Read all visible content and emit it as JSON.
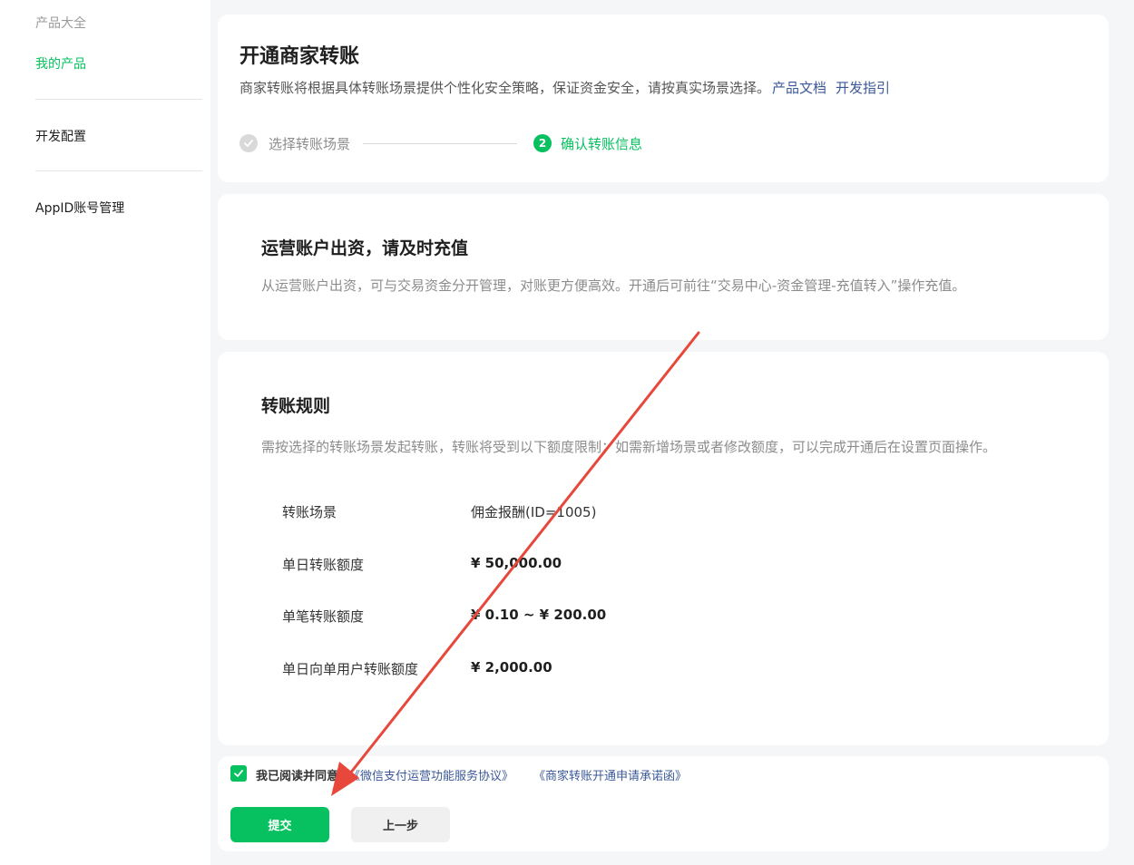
{
  "sidebar": {
    "group_title": "产品大全",
    "items": [
      {
        "label": "我的产品"
      },
      {
        "label": "开发配置"
      },
      {
        "label": "AppID账号管理"
      }
    ]
  },
  "header": {
    "title": "开通商家转账",
    "description": "商家转账将根据具体转账场景提供个性化安全策略，保证资金安全，请按真实场景选择。",
    "links": {
      "doc": "产品文档",
      "guide": "开发指引"
    }
  },
  "steps": [
    {
      "label": "选择转账场景",
      "status": "done"
    },
    {
      "number": "2",
      "label": "确认转账信息",
      "status": "active"
    }
  ],
  "operating_account": {
    "title": "运营账户出资，请及时充值",
    "description": "从运营账户出资，可与交易资金分开管理，对账更方便高效。开通后可前往“交易中心-资金管理-充值转入”操作充值。"
  },
  "rules": {
    "title": "转账规则",
    "description": "需按选择的转账场景发起转账，转账将受到以下额度限制；如需新增场景或者修改额度，可以完成开通后在设置页面操作。",
    "rows": [
      {
        "label": "转账场景",
        "value": "佣金报酬(ID=1005)"
      },
      {
        "label": "单日转账额度",
        "value": "¥ 50,000.00"
      },
      {
        "label": "单笔转账额度",
        "value": "¥ 0.10 ~ ¥ 200.00"
      },
      {
        "label": "单日向单用户转账额度",
        "value": "¥ 2,000.00"
      }
    ]
  },
  "footer": {
    "agree_text": "我已阅读并同意",
    "agreement_1": "《微信支付运营功能服务协议》",
    "agreement_2": "《商家转账开通申请承诺函》",
    "submit_label": "提交",
    "prev_label": "上一步"
  },
  "colors": {
    "accent": "#07c160",
    "link": "#3b5998",
    "annotation": "#e8473b"
  }
}
